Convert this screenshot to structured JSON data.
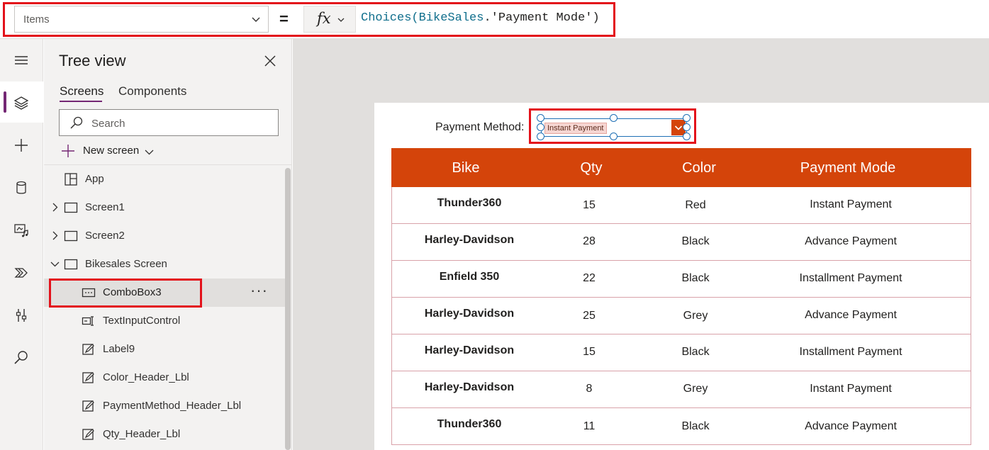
{
  "formula_bar": {
    "property": "Items",
    "equals": "=",
    "fx": "fx",
    "formula": {
      "fn": "Choices(",
      "source": "BikeSales",
      "dot": ".",
      "column": "'Payment Mode'",
      "close": ")"
    }
  },
  "left_rail": {
    "icons": [
      "hamburger-icon",
      "layers-icon",
      "plus-icon",
      "database-icon",
      "media-icon",
      "variables-icon",
      "tools-icon",
      "search-icon"
    ]
  },
  "tree_view": {
    "title": "Tree view",
    "tabs": [
      {
        "label": "Screens",
        "active": true
      },
      {
        "label": "Components",
        "active": false
      }
    ],
    "search_placeholder": "Search",
    "new_screen_label": "New screen",
    "items": [
      {
        "label": "App",
        "icon": "app-icon",
        "level": 0
      },
      {
        "label": "Screen1",
        "icon": "screen-icon",
        "level": 0,
        "expander": "collapsed"
      },
      {
        "label": "Screen2",
        "icon": "screen-icon",
        "level": 0,
        "expander": "collapsed"
      },
      {
        "label": "Bikesales Screen",
        "icon": "screen-icon",
        "level": 0,
        "expander": "expanded"
      },
      {
        "label": "ComboBox3",
        "icon": "combobox-icon",
        "level": 1,
        "selected": true
      },
      {
        "label": "TextInputControl",
        "icon": "textinput-icon",
        "level": 1
      },
      {
        "label": "Label9",
        "icon": "label-icon",
        "level": 1
      },
      {
        "label": "Color_Header_Lbl",
        "icon": "label-icon",
        "level": 1
      },
      {
        "label": "PaymentMethod_Header_Lbl",
        "icon": "label-icon",
        "level": 1
      },
      {
        "label": "Qty_Header_Lbl",
        "icon": "label-icon",
        "level": 1
      }
    ],
    "more_label": "···"
  },
  "canvas": {
    "payment_label": "Payment Method:",
    "combo_selected": "Instant Payment",
    "table": {
      "columns": [
        "Bike",
        "Qty",
        "Color",
        "Payment Mode"
      ],
      "rows": [
        [
          "Thunder360",
          "15",
          "Red",
          "Instant Payment"
        ],
        [
          "Harley-Davidson",
          "28",
          "Black",
          "Advance Payment"
        ],
        [
          "Enfield 350",
          "22",
          "Black",
          "Installment Payment"
        ],
        [
          "Harley-Davidson",
          "25",
          "Grey",
          "Advance Payment"
        ],
        [
          "Harley-Davidson",
          "15",
          "Black",
          "Installment Payment"
        ],
        [
          "Harley-Davidson",
          "8",
          "Grey",
          "Instant Payment"
        ],
        [
          "Thunder360",
          "11",
          "Black",
          "Advance Payment"
        ]
      ]
    }
  },
  "colors": {
    "header_bg": "#d4440a",
    "highlight_frame": "#e3121b",
    "accent_purple": "#742774",
    "row_border": "#d9a2a9"
  }
}
